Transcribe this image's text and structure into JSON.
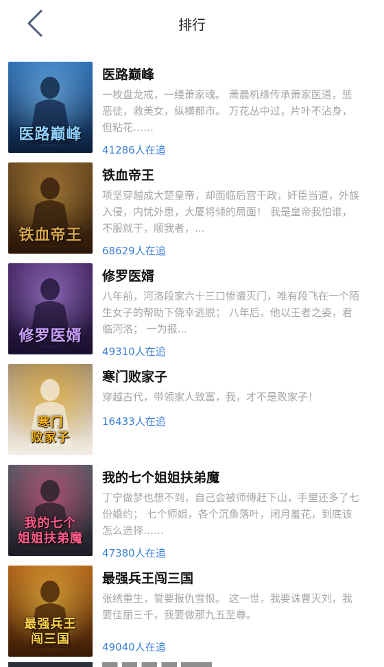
{
  "header": {
    "title": "排行",
    "back_icon": "chevron-left-icon",
    "accent": "#4a5a78"
  },
  "books": [
    {
      "title": "医路巅峰",
      "cover_text": "医路巅峰",
      "description": "一枚盘龙戒，一缕萧家魂。 萧晨机缘传承萧家医道，惩恶徒，救美女，纵横都市。 万花丛中过，片叶不沾身，但粘花……",
      "followers": "41286人在追",
      "cover_colors": [
        "#0b1d3a",
        "#2c6fb5",
        "#8fd0ff"
      ]
    },
    {
      "title": "铁血帝王",
      "cover_text": "铁血帝王",
      "description": "项坚穿越成大楚皇帝，却面临后宫干政，奸臣当道，外族入侵，内忧外患，大厦将倾的局面！ 我是皇帝我怕谁，不服就干，顺我者，...",
      "followers": "68629人在追",
      "cover_colors": [
        "#2a1608",
        "#6b4a22",
        "#d6a447"
      ]
    },
    {
      "title": "修罗医婿",
      "cover_text": "修罗医婿",
      "description": "八年前，河洛段家六十三口惨遭灭门，唯有段飞在一个陌生女子的帮助下侥幸逃脱； 八年后，他以王者之姿，君临河洛； 一为报...",
      "followers": "49310人在追",
      "cover_colors": [
        "#1a0f2e",
        "#4a2a6a",
        "#c9a0ff"
      ]
    },
    {
      "title": "寒门败家子",
      "cover_text": "寒门\n败家子",
      "description": "穿越古代，带领家人致富，我，才不是败家子！",
      "followers": "16433人在追",
      "cover_colors": [
        "#f4efe6",
        "#a38b6a",
        "#f2b21a"
      ]
    },
    {
      "title": "我的七个姐姐扶弟魔",
      "cover_text": "我的七个\n姐姐扶弟魔",
      "description": "丁宁做梦也想不到，自己会被师傅赶下山，手里还多了七份婚约； 七个师姐，各个沉鱼落叶，闭月羞花，到底该怎么选择……",
      "followers": "47380人在追",
      "cover_colors": [
        "#1c1c24",
        "#5a5a66",
        "#ff5a8a"
      ]
    },
    {
      "title": "最强兵王闯三国",
      "cover_text": "最强兵王\n闯三国",
      "description": "张绣重生，誓要报仇雪恨。 这一世，我要诛曹灭刘，我要佳丽三千，我要做那九五至尊。",
      "followers": "49040人在追",
      "cover_colors": [
        "#3a1a06",
        "#b0621a",
        "#ffd34a"
      ]
    }
  ]
}
